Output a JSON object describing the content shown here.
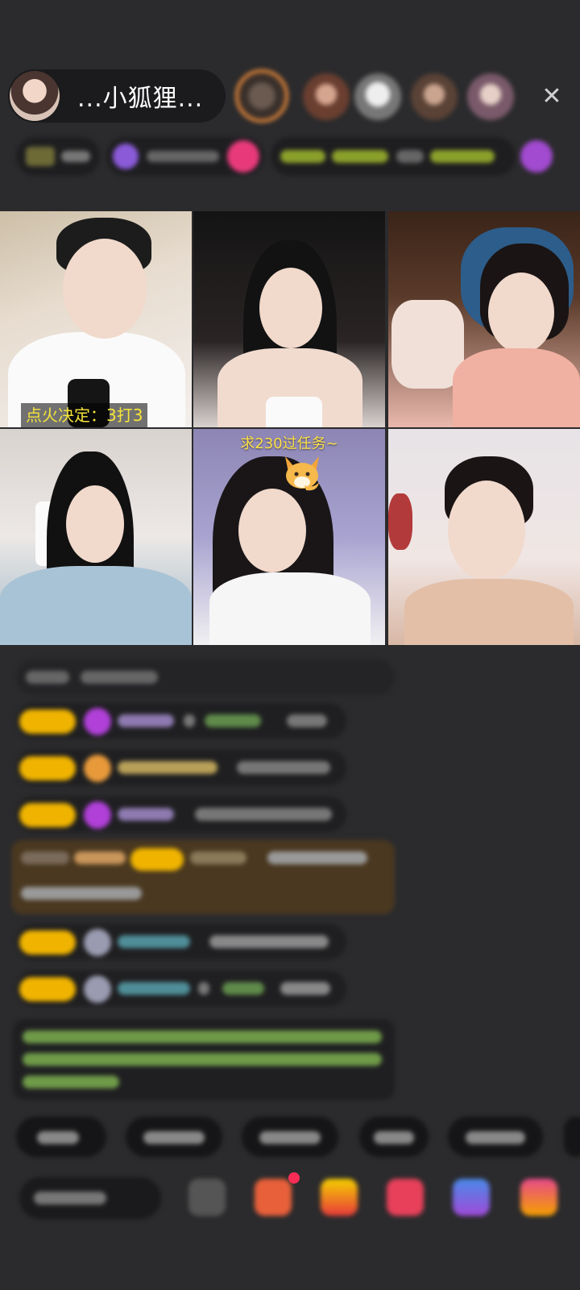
{
  "header": {
    "host_name": "...小狐狸...",
    "close_icon": "close-icon"
  },
  "video": {
    "tile1_caption": "点火决定：3打3",
    "tile5_caption": "求230过任务~"
  },
  "colors": {
    "background": "#2b2b2d",
    "badge": "#f0b400",
    "caption_yellow": "#f5e43a",
    "gift_row": "#4a3820",
    "avatar_ring": "#e8893a"
  }
}
